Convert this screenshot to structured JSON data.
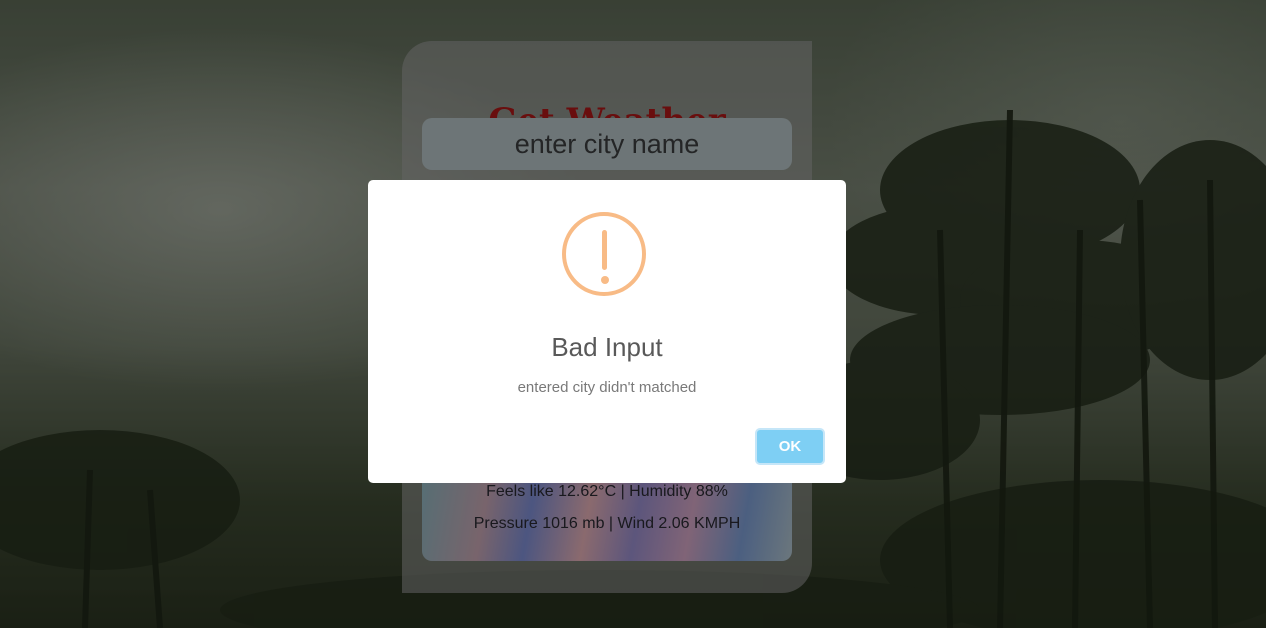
{
  "app": {
    "title": "Get Weather",
    "search": {
      "placeholder": "enter city name",
      "value": ""
    },
    "result": {
      "line1": "Feels like 12.62°C | Humidity 88%",
      "line2": "Pressure 1016 mb | Wind 2.06 KMPH"
    },
    "colors": {
      "title": "#b01818",
      "input_bg": "#b6c4c6"
    }
  },
  "alert": {
    "icon": "warning-icon",
    "title": "Bad Input",
    "text": "entered city didn't matched",
    "button_label": "OK",
    "colors": {
      "icon": "#f8bb86",
      "button": "#7ecff4"
    }
  }
}
